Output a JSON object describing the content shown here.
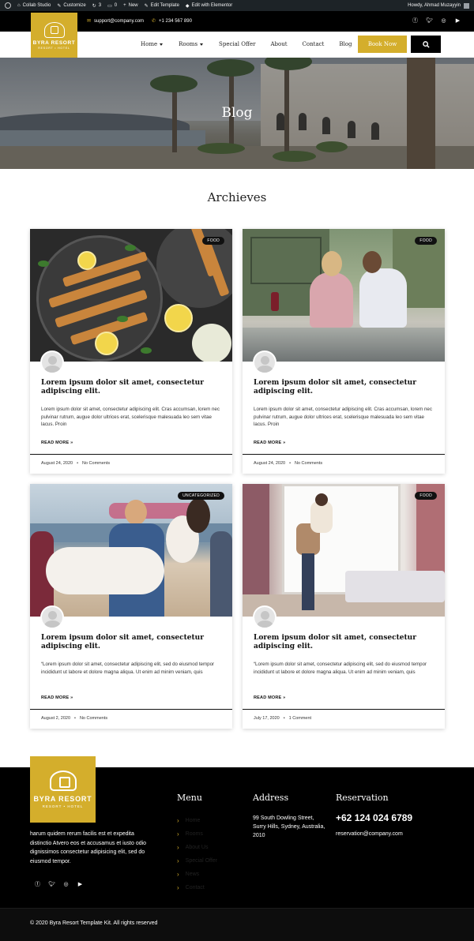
{
  "admin_bar": {
    "site_name": "Collab Studio",
    "customize": "Customize",
    "updates_count": "3",
    "comments_count": "0",
    "new": "New",
    "edit_template": "Edit Template",
    "edit_elementor": "Edit with Elementor",
    "howdy": "Howdy, Ahmad Muzayyin"
  },
  "topbar": {
    "email": "support@company.com",
    "phone": "+1 234 567 890",
    "social_icons": [
      "facebook-icon",
      "twitter-icon",
      "instagram-icon",
      "youtube-icon"
    ]
  },
  "logo": {
    "name": "BYRA RESORT",
    "tagline": "RESORT • HOTEL"
  },
  "nav": {
    "items": [
      {
        "label": "Home",
        "dropdown": true
      },
      {
        "label": "Rooms",
        "dropdown": true
      },
      {
        "label": "Special Offer",
        "dropdown": false
      },
      {
        "label": "About",
        "dropdown": false
      },
      {
        "label": "Contact",
        "dropdown": false
      },
      {
        "label": "Blog",
        "dropdown": false
      }
    ],
    "book_now": "Book Now"
  },
  "hero": {
    "title": "Blog"
  },
  "section": {
    "title": "Archieves"
  },
  "posts": [
    {
      "category": "FOOD",
      "title": "Lorem ipsum dolor sit amet, consectetur adipiscing elit.",
      "excerpt": "Lorem ipsum dolor sit amet, consectetur adipiscing elit. Cras accumsan, lorem nec pulvinar rutrum, augue dolor ultrices erat, scelerisque malesuada leo sem vitae lacus. Proin",
      "read_more": "READ MORE »",
      "date": "August 24, 2020",
      "comments": "No Comments"
    },
    {
      "category": "FOOD",
      "title": "Lorem ipsum dolor sit amet, consectetur adipiscing elit.",
      "excerpt": "Lorem ipsum dolor sit amet, consectetur adipiscing elit. Cras accumsan, lorem nec pulvinar rutrum, augue dolor ultrices erat, scelerisque malesuada leo sem vitae lacus. Proin",
      "read_more": "READ MORE »",
      "date": "August 24, 2020",
      "comments": "No Comments"
    },
    {
      "category": "UNCATEGORIZED",
      "title": "Lorem ipsum dolor sit amet, consectetur adipiscing elit.",
      "excerpt": "“Lorem ipsum dolor sit amet, consectetur adipiscing elit, sed do eiusmod tempor incididunt ut labore et dolore magna aliqua. Ut enim ad minim veniam, quis",
      "read_more": "READ MORE »",
      "date": "August 2, 2020",
      "comments": "No Comments"
    },
    {
      "category": "FOOD",
      "title": "Lorem ipsum dolor sit amet, consectetur adipiscing elit.",
      "excerpt": "“Lorem ipsum dolor sit amet, consectetur adipiscing elit, sed do eiusmod tempor incididunt ut labore et dolore magna aliqua. Ut enim ad minim veniam, quis",
      "read_more": "READ MORE »",
      "date": "July 17, 2020",
      "comments": "1 Comment"
    }
  ],
  "footer": {
    "logo_name": "BYRA RESORT",
    "logo_tagline": "RESORT • HOTEL",
    "about": "harum quidem rerum facilis est et expedita distinctio Atvero eos et accusamus et iusto odio dignissimos consectetur adipisicing elit, sed do eiusmod tempor.",
    "menu_heading": "Menu",
    "menu": [
      "Home",
      "Rooms",
      "About Us",
      "Special Offer",
      "News",
      "Contact"
    ],
    "address_heading": "Address",
    "address": "99 South Dowling Street, Surry Hills, Sydney, Australia, 2010",
    "reservation_heading": "Reservation",
    "reservation_phone": "+62 124 024 6789",
    "reservation_email": "reservation@company.com",
    "copyright": "© 2020 Byra Resort Template Kit. All rights reserved"
  },
  "colors": {
    "accent": "#d4ae2c",
    "dark": "#000000",
    "admin_bar": "#1d2327"
  }
}
